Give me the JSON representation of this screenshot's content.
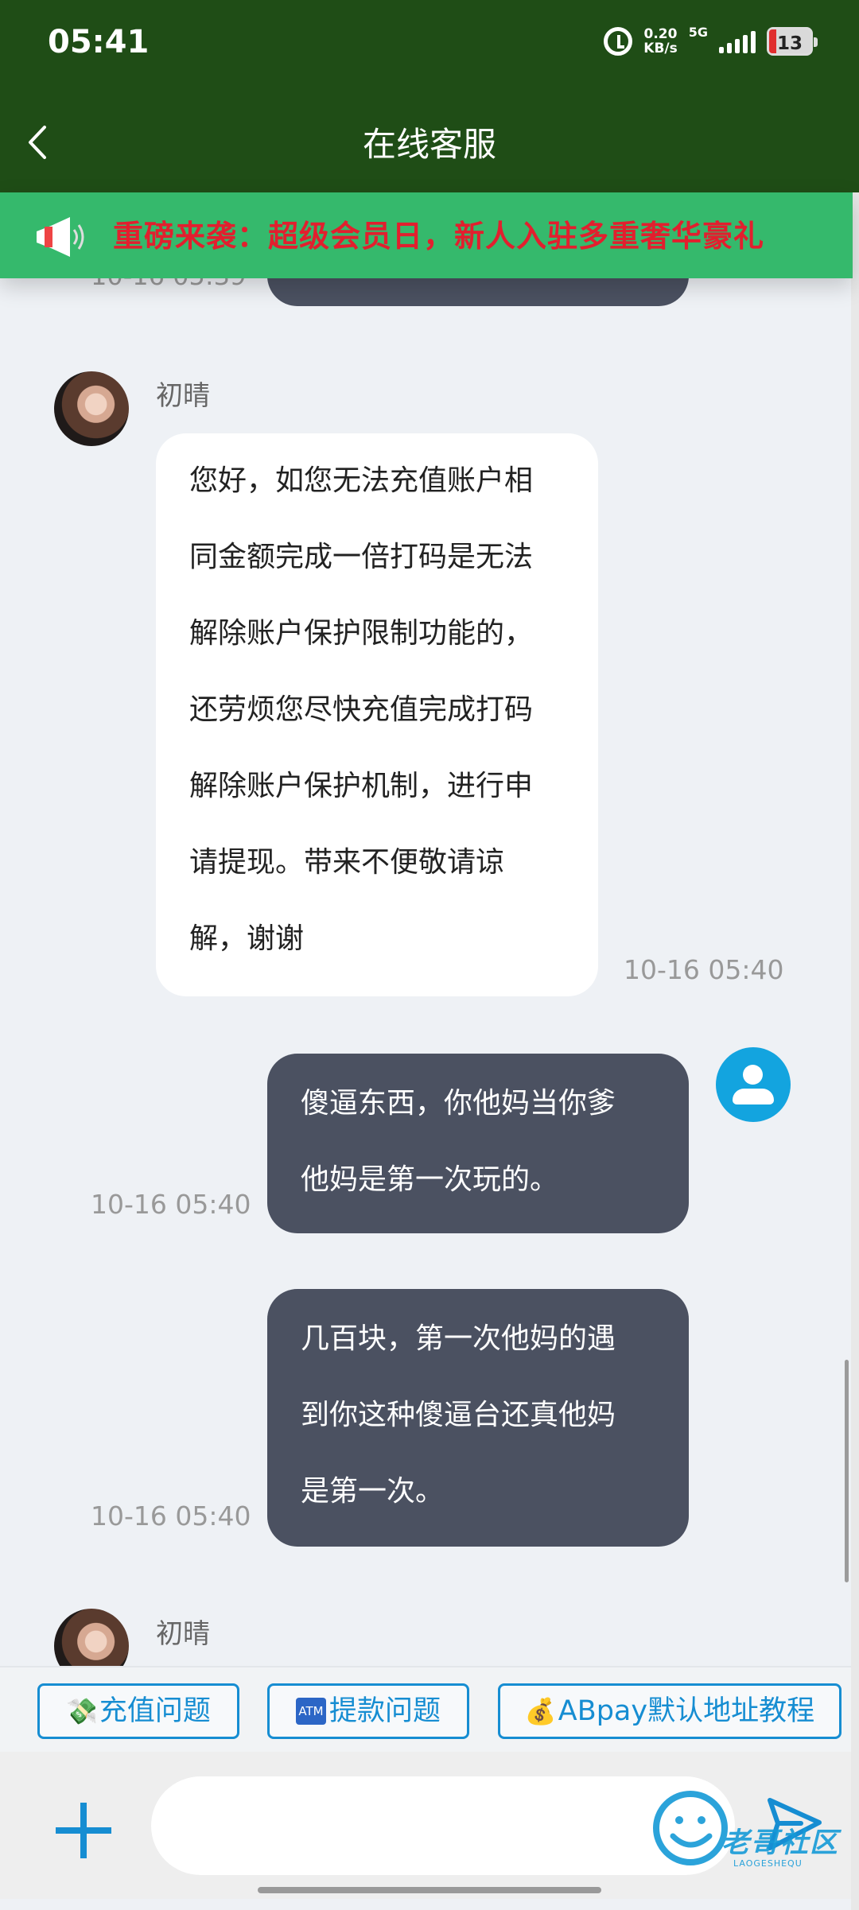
{
  "status_bar": {
    "time": "05:41",
    "network_speed_value": "0.20",
    "network_speed_unit": "KB/s",
    "network_type": "5G",
    "battery_level": "13"
  },
  "header": {
    "title": "在线客服",
    "back_icon": "chevron-left-icon"
  },
  "announcement": {
    "text": "重磅来袭：超级会员日，新人入驻多重奢华豪礼",
    "icon": "megaphone-icon"
  },
  "chat": {
    "previous_time": "10-16 05:39",
    "messages": [
      {
        "sender": "初晴",
        "direction": "incoming",
        "lines": [
          "您好，如您无法充值账户相",
          "同金额完成一倍打码是无法",
          "解除账户保护限制功能的，",
          "还劳烦您尽快充值完成打码",
          "解除账户保护机制，进行申",
          "请提现。带来不便敬请谅",
          "解，谢谢"
        ],
        "time": "10-16 05:40"
      },
      {
        "direction": "outgoing",
        "lines": [
          "傻逼东西，你他妈当你爹",
          "他妈是第一次玩的。"
        ],
        "time": "10-16 05:40"
      },
      {
        "direction": "outgoing",
        "lines": [
          "几百块，第一次他妈的遇",
          "到你这种傻逼台还真他妈",
          "是第一次。"
        ],
        "time": "10-16 05:40"
      },
      {
        "sender": "初晴",
        "direction": "incoming"
      }
    ]
  },
  "quick_actions": [
    {
      "icon": "💸",
      "label": "充值问题"
    },
    {
      "icon": "ATM",
      "label": "提款问题"
    },
    {
      "icon": "💰",
      "label": "ABpay默认地址教程"
    }
  ],
  "composer": {
    "placeholder": "",
    "add_icon": "plus-icon",
    "send_icon": "send-icon"
  },
  "watermark": {
    "title": "老哥社区",
    "subtitle": "LAOGESHEQU"
  },
  "colors": {
    "header_bg": "#1f4d16",
    "announcement_bg": "#35b96c",
    "announcement_text": "#e21f2e",
    "accent": "#168dd2",
    "outgoing_bubble": "#4b5161"
  }
}
